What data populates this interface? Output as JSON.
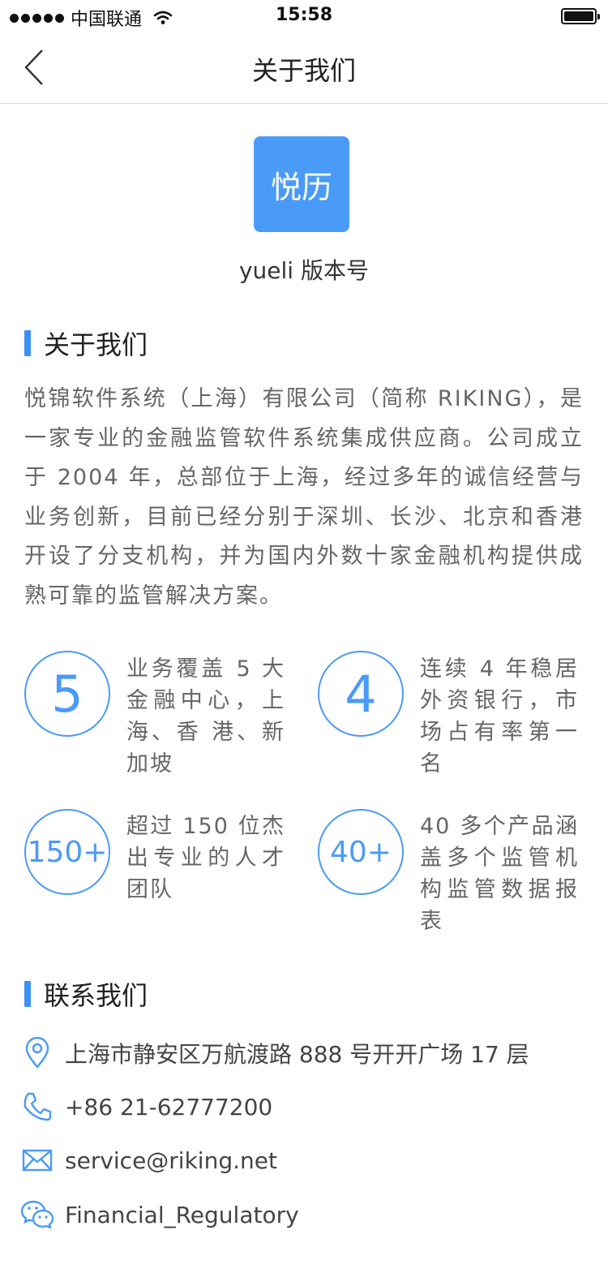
{
  "status_bar": {
    "carrier": "中国联通",
    "time": "15:58"
  },
  "nav": {
    "title": "关于我们"
  },
  "app": {
    "logo_text": "悦历",
    "version_label": "yueli 版本号"
  },
  "about": {
    "section_title": "关于我们",
    "text": "悦锦软件系统（上海）有限公司（简称 RIKING），是一家专业的金融监管软件系统集成供应商。公司成立于 2004 年，总部位于上海，经过多年的诚信经营与业务创新，目前已经分别于深圳、长沙、北京和香港开设了分支机构，并为国内外数十家金融机构提供成熟可靠的监管解决方案。"
  },
  "stats": [
    {
      "value": "5",
      "text": "业务覆盖 5 大金融中心，上海、香 港、新加坡"
    },
    {
      "value": "4",
      "text": "连续 4 年稳居外资银行，市场占有率第一名"
    },
    {
      "value": "150+",
      "text": "超过 150 位杰出专业的人才团队"
    },
    {
      "value": "40+",
      "text": "40 多个产品涵盖多个监管机构监管数据报表"
    }
  ],
  "contact": {
    "section_title": "联系我们",
    "address": "上海市静安区万航渡路 888 号开开广场 17 层",
    "phone": "+86 21-62777200",
    "email": "service@riking.net",
    "wechat": "Financial_Regulatory"
  },
  "colors": {
    "accent": "#4a9bf7",
    "text_secondary": "#666666"
  },
  "icons": [
    "chevron-left-icon",
    "wifi-icon",
    "battery-icon",
    "location-icon",
    "phone-icon",
    "mail-icon",
    "wechat-icon"
  ]
}
